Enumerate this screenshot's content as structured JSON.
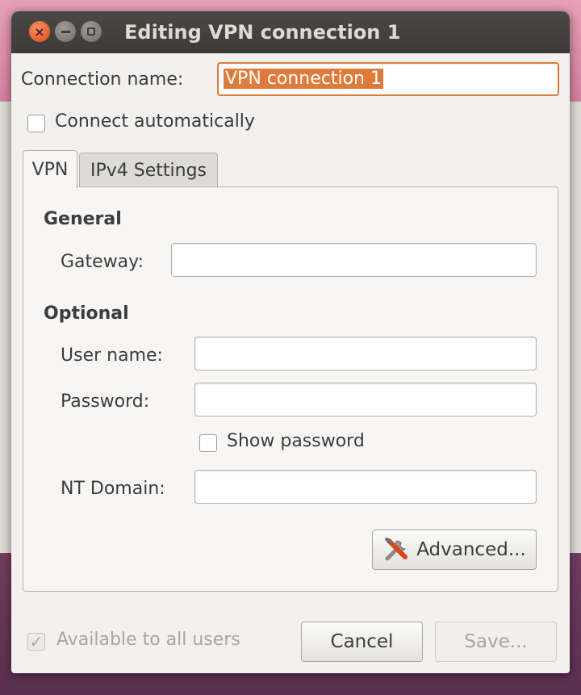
{
  "window": {
    "title": "Editing VPN connection 1"
  },
  "connection": {
    "name_label": "Connection name:",
    "name_value": "VPN connection 1",
    "connect_auto_label": "Connect automatically",
    "connect_auto_checked": false
  },
  "tabs": [
    {
      "label": "VPN",
      "active": true
    },
    {
      "label": "IPv4 Settings",
      "active": false
    }
  ],
  "general": {
    "heading": "General",
    "gateway_label": "Gateway:",
    "gateway_value": ""
  },
  "optional": {
    "heading": "Optional",
    "username_label": "User name:",
    "username_value": "",
    "password_label": "Password:",
    "password_value": "",
    "show_password_label": "Show password",
    "show_password_checked": false,
    "nt_domain_label": "NT Domain:",
    "nt_domain_value": ""
  },
  "advanced_label": "Advanced...",
  "footer": {
    "available_label": "Available to all users",
    "available_checked": true,
    "cancel_label": "Cancel",
    "save_label": "Save..."
  },
  "colors": {
    "titlebar": "#3c3b37",
    "close_button": "#df4a16",
    "focus_accent": "#e07a3a",
    "dialog_bg": "#f2f1f0"
  }
}
